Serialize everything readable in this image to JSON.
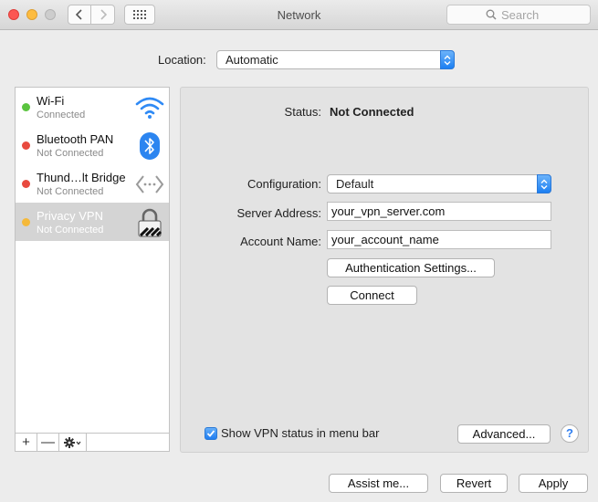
{
  "window": {
    "title": "Network"
  },
  "toolbar": {
    "back_icon": "chevron-left-icon",
    "forward_icon": "chevron-right-icon",
    "grid_icon": "show-all-grid-icon",
    "search_placeholder": "Search"
  },
  "location": {
    "label": "Location:",
    "value": "Automatic"
  },
  "sidebar": {
    "items": [
      {
        "name": "Wi-Fi",
        "status": "Connected",
        "dot_color": "#5ac43f",
        "icon": "wifi-icon"
      },
      {
        "name": "Bluetooth PAN",
        "status": "Not Connected",
        "dot_color": "#e84a3f",
        "icon": "bluetooth-icon"
      },
      {
        "name": "Thund…lt Bridge",
        "status": "Not Connected",
        "dot_color": "#e84a3f",
        "icon": "thunderbolt-bridge-icon"
      },
      {
        "name": "Privacy VPN",
        "status": "Not Connected",
        "dot_color": "#f5b93a",
        "icon": "vpn-lock-icon",
        "selected": true
      }
    ],
    "footer": {
      "add": "+",
      "remove": "—",
      "gear_icon": "gear-icon"
    }
  },
  "detail": {
    "status_label": "Status:",
    "status_value": "Not Connected",
    "configuration_label": "Configuration:",
    "configuration_value": "Default",
    "server_label": "Server Address:",
    "server_value": "your_vpn_server.com",
    "account_label": "Account Name:",
    "account_value": "your_account_name",
    "auth_button": "Authentication Settings...",
    "connect_button": "Connect",
    "show_status_label": "Show VPN status in menu bar",
    "show_status_checked": true,
    "advanced_button": "Advanced...",
    "help": "?"
  },
  "bottom": {
    "assist": "Assist me...",
    "revert": "Revert",
    "apply": "Apply"
  },
  "colors": {
    "accent": "#1c7ff2",
    "selection": "#d4d4d4"
  }
}
